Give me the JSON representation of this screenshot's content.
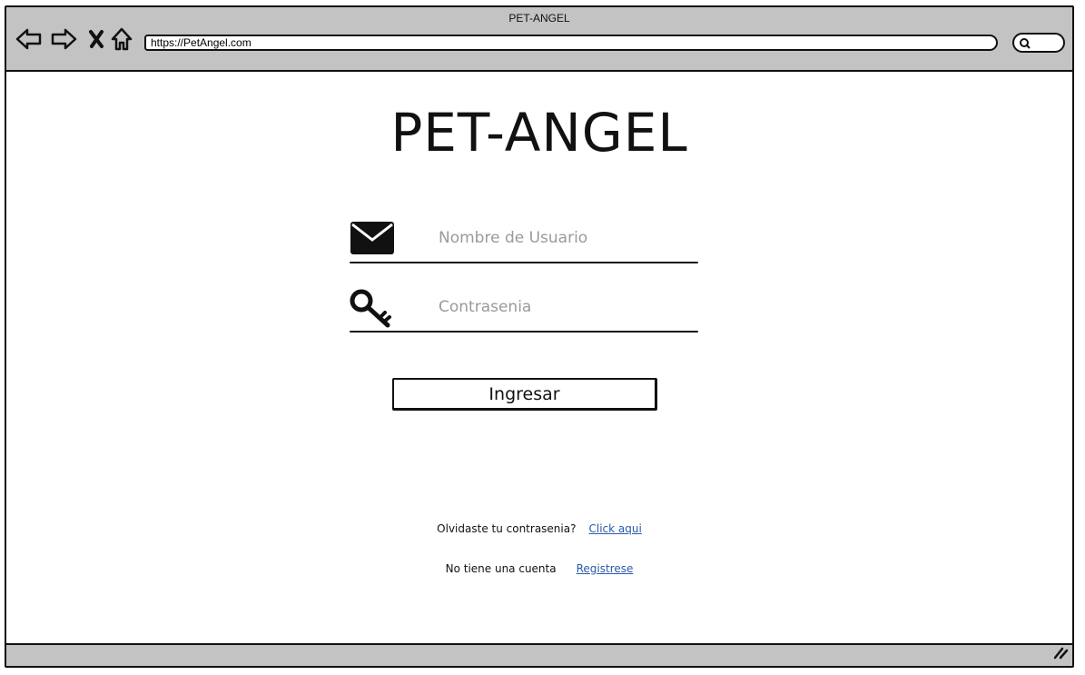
{
  "window": {
    "title": "PET-ANGEL",
    "url": "https://PetAngel.com"
  },
  "icons": {
    "back": "back-arrow-icon",
    "forward": "forward-arrow-icon",
    "close": "close-icon",
    "home": "home-icon",
    "search": "search-icon",
    "user_field": "envelope-icon",
    "password_field": "key-icon",
    "resize": "resize-grip-icon"
  },
  "main": {
    "title": "PET-ANGEL",
    "username": {
      "placeholder": "Nombre de Usuario",
      "value": ""
    },
    "password": {
      "placeholder": "Contrasenia",
      "value": ""
    },
    "login_button": "Ingresar",
    "forgot": {
      "text": "Olvidaste tu contrasenia?",
      "link": "Click aqui"
    },
    "register": {
      "text": "No tiene una cuenta",
      "link": "Registrese"
    }
  },
  "colors": {
    "chrome": "#c3c3c3",
    "link": "#2a5aa8",
    "placeholder": "#9a9a9a"
  }
}
